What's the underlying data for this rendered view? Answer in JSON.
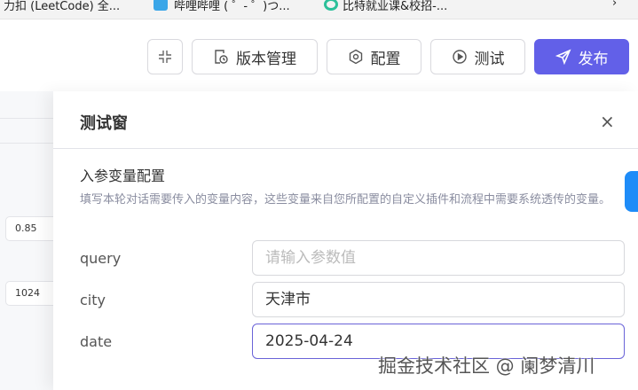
{
  "bookmarks": [
    {
      "label": "力扣 (LeetCode) 全..."
    },
    {
      "label": "哔哩哔哩 ( ゜- ゜)つ..."
    },
    {
      "label": "比特就业课&校招-..."
    }
  ],
  "bookmarks_more": "›",
  "toolbar": {
    "collapse_icon": "collapse-icon",
    "version": "版本管理",
    "config": "配置",
    "test": "测试",
    "publish": "发布"
  },
  "background_panel": {
    "value1": "0.85",
    "value2": "1024"
  },
  "drawer": {
    "title": "测试窗",
    "close": "×",
    "section_title": "入参变量配置",
    "description": "填写本轮对话需要传入的变量内容，这些变量来自您所配置的自定义插件和流程中需要系统透传的变量。",
    "fields": [
      {
        "label": "query",
        "value": "",
        "placeholder": "请输入参数值"
      },
      {
        "label": "city",
        "value": "天津市"
      },
      {
        "label": "date",
        "value": "2025-04-24"
      }
    ]
  },
  "watermark": "掘金技术社区 @ 阑梦清川",
  "colors": {
    "primary": "#6260e8",
    "focus": "#6a63d8"
  }
}
